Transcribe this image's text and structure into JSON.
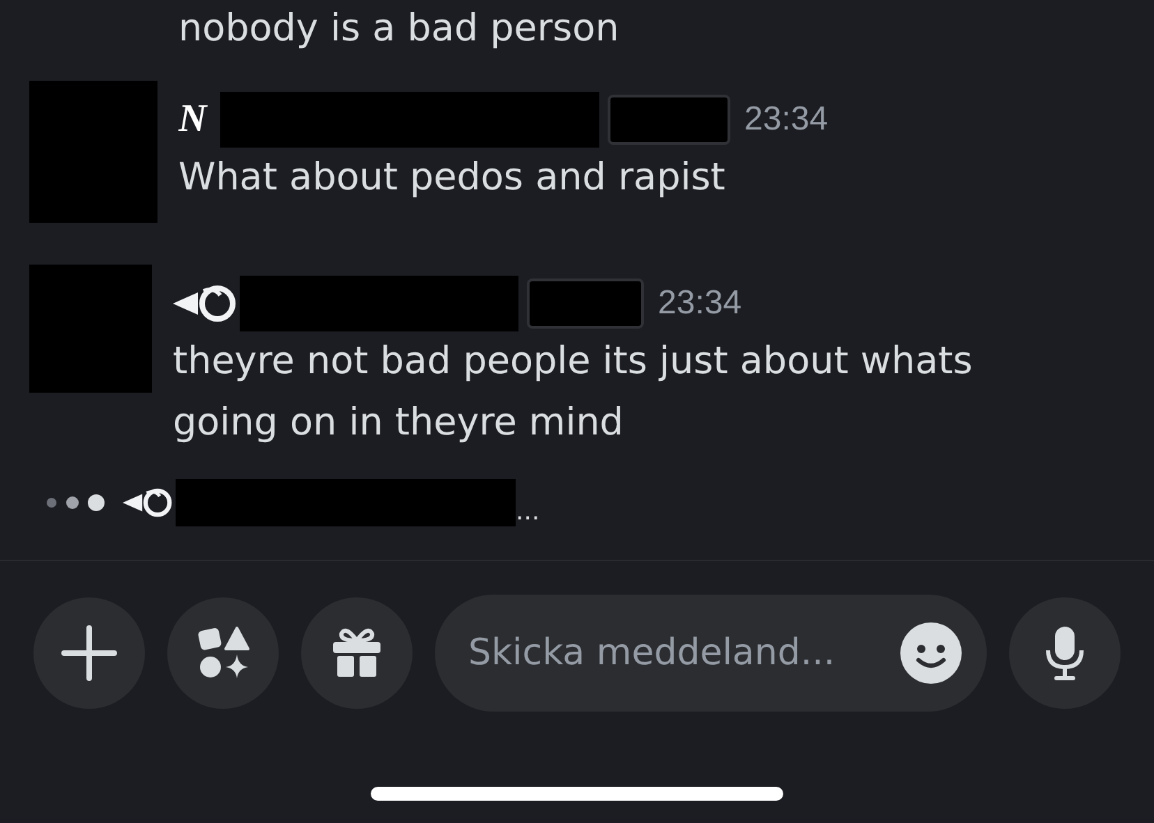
{
  "top_message": "nobody is a bad person",
  "messages": [
    {
      "prefix": {
        "kind": "text",
        "text": "N"
      },
      "time": "23:34",
      "lines": [
        "What about pedos and rapist"
      ]
    },
    {
      "prefix": {
        "kind": "glyph"
      },
      "time": "23:34",
      "lines": [
        "theyre not bad people its just about whats",
        "going on in theyre mind"
      ]
    }
  ],
  "typing": {
    "prefix": {
      "kind": "glyph"
    },
    "suffix": "..."
  },
  "composer": {
    "placeholder": "Skicka meddeland..."
  }
}
